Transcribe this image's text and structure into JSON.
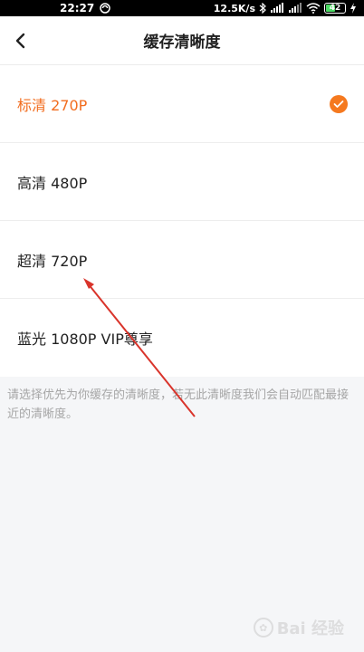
{
  "status_bar": {
    "time": "22:27",
    "network_speed": "12.5K/s",
    "battery": "42",
    "icons": [
      "no-disturb-icon",
      "bluetooth-icon",
      "signal-hd-icon",
      "signal-hd-icon-2",
      "wifi-icon",
      "battery-icon",
      "charging-icon"
    ]
  },
  "header": {
    "title": "缓存清晰度",
    "back_icon": "back-arrow-icon"
  },
  "options": [
    {
      "label": "标清 270P",
      "selected": true
    },
    {
      "label": "高清 480P",
      "selected": false
    },
    {
      "label": "超清 720P",
      "selected": false
    },
    {
      "label": "蓝光 1080P  VIP尊享",
      "selected": false
    }
  ],
  "hint": "请选择优先为你缓存的清晰度，若无此清晰度我们会自动匹配最接近的清晰度。",
  "watermark": "Bai 经验",
  "colors": {
    "accent": "#f26d1f",
    "annotation_arrow": "#d9342b"
  }
}
